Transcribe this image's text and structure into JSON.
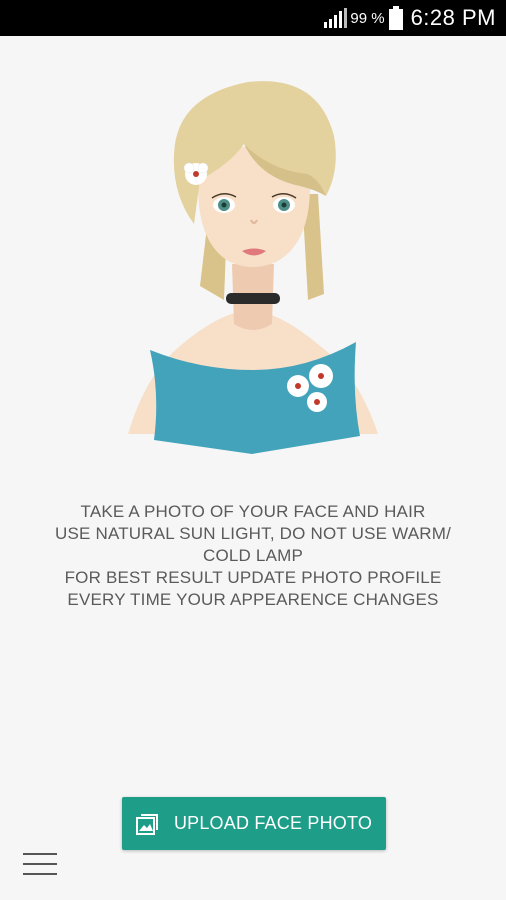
{
  "status_bar": {
    "battery_percent": "99 %",
    "time": "6:28 PM"
  },
  "instructions": {
    "lines": [
      "TAKE A PHOTO OF YOUR FACE AND HAIR",
      "USE NATURAL SUN LIGHT, DO NOT USE WARM/",
      "COLD LAMP",
      "FOR BEST RESULT UPDATE PHOTO PROFILE",
      "EVERY TIME YOUR APPEARENCE CHANGES"
    ]
  },
  "upload_button": {
    "label": "UPLOAD FACE PHOTO",
    "icon": "gallery-icon"
  },
  "menu": {
    "icon": "hamburger-menu-icon"
  },
  "colors": {
    "accent": "#1e9e88",
    "dress": "#43a3bb",
    "hair": "#e4d29e",
    "skin": "#f7dfc8",
    "background": "#f6f6f6"
  }
}
